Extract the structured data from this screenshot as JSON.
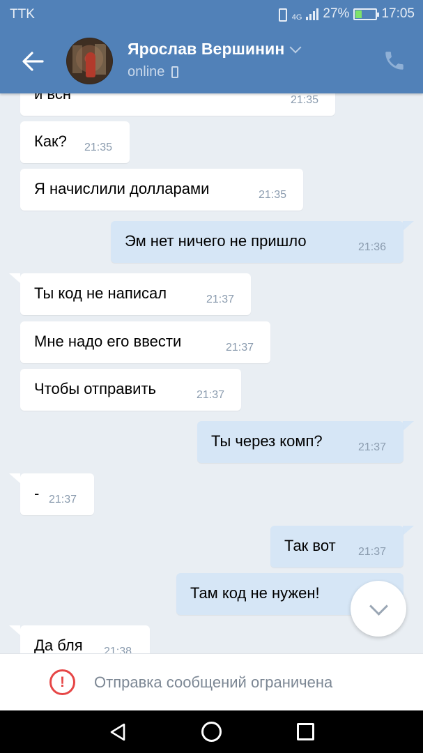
{
  "status_bar": {
    "carrier": "TTK",
    "network": "4G",
    "battery": "27%",
    "time": "17:05"
  },
  "header": {
    "contact_name": "Ярослав Вершинин",
    "presence": "online"
  },
  "messages": [
    {
      "direction": "in",
      "text": "и всн",
      "time": "21:35"
    },
    {
      "direction": "in",
      "text": "Как?",
      "time": "21:35"
    },
    {
      "direction": "in",
      "text": "Я начислили долларами",
      "time": "21:35"
    },
    {
      "direction": "out",
      "text": "Эм нет ничего не пришло",
      "time": "21:36"
    },
    {
      "direction": "in",
      "text": "Ты код не написал",
      "time": "21:37"
    },
    {
      "direction": "in",
      "text": "Мне надо его ввести",
      "time": "21:37"
    },
    {
      "direction": "in",
      "text": "Чтобы отправить",
      "time": "21:37"
    },
    {
      "direction": "out",
      "text": "Ты через комп?",
      "time": "21:37"
    },
    {
      "direction": "in",
      "text": "-",
      "time": "21:37"
    },
    {
      "direction": "out",
      "text": "Так вот",
      "time": "21:37"
    },
    {
      "direction": "out",
      "text": "Там код не нужен!",
      "time": ""
    },
    {
      "direction": "in",
      "text": "Да бля",
      "time": "21:38"
    }
  ],
  "restriction": {
    "text": "Отправка сообщений ограничена"
  },
  "colors": {
    "header": "#5181b8",
    "chat_bg": "#e9eef3",
    "incoming_bubble": "#ffffff",
    "outgoing_bubble": "#d6e6f6",
    "warning": "#e64646"
  },
  "icons": {
    "back": "arrow-left-icon",
    "call": "phone-icon",
    "scroll_down": "chevron-down-icon",
    "warning": "exclamation-circle-icon"
  }
}
